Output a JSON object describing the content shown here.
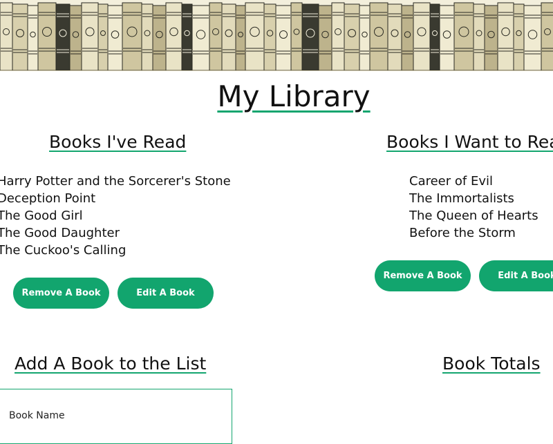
{
  "header": {
    "title": "My Library"
  },
  "read_section": {
    "title": "Books I've Read",
    "books": [
      "Harry Potter and the Sorcerer's Stone",
      "Deception Point",
      "The Good Girl",
      "The Good Daughter",
      "The Cuckoo's Calling"
    ],
    "remove_label": "Remove A Book",
    "edit_label": "Edit A Book"
  },
  "want_section": {
    "title": "Books I Want to Read",
    "books": [
      "Career of Evil",
      "The Immortalists",
      "The Queen of Hearts",
      "Before the Storm"
    ],
    "remove_label": "Remove A Book",
    "edit_label": "Edit A Book"
  },
  "add_section": {
    "title": "Add A Book to the List",
    "book_name_label": "Book Name"
  },
  "totals_section": {
    "title": "Book Totals"
  },
  "colors": {
    "accent": "#12a56e",
    "banner_paper": "#f3efdc",
    "banner_ink": "#2a2a22"
  }
}
